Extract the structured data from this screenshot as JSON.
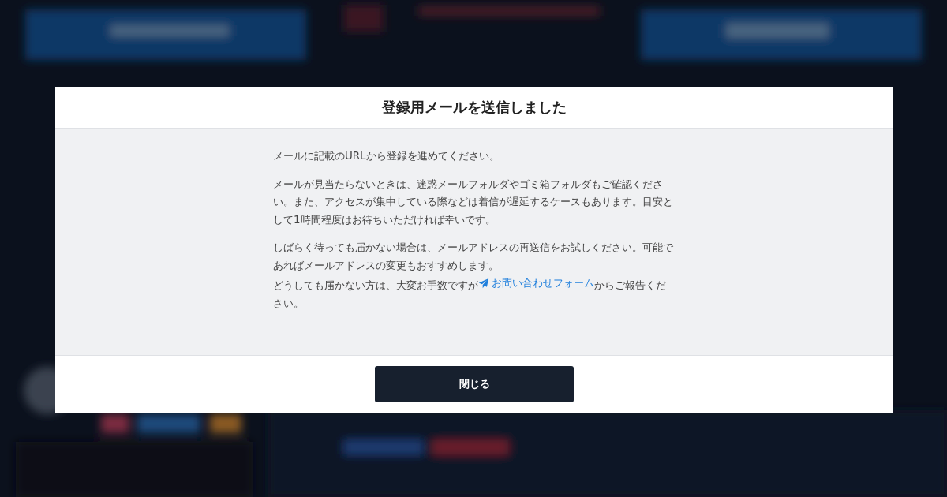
{
  "dialog": {
    "title": "登録用メールを送信しました",
    "paragraphs": [
      "メールに記載のURLから登録を進めてください。",
      "メールが見当たらないときは、迷惑メールフォルダやゴミ箱フォルダもご確認ください。また、アクセスが集中している際などは着信が遅延するケースもあります。目安として1時間程度はお待ちいただければ幸いです。",
      "しばらく待っても届かない場合は、メールアドレスの再送信をお試しください。可能であればメールアドレスの変更もおすすめします。"
    ],
    "contact": {
      "before": "どうしても届かない方は、大変お手数ですが",
      "link": "お問い合わせフォーム",
      "after": "からご報告ください。"
    },
    "buttons": [
      "閉じる"
    ]
  }
}
